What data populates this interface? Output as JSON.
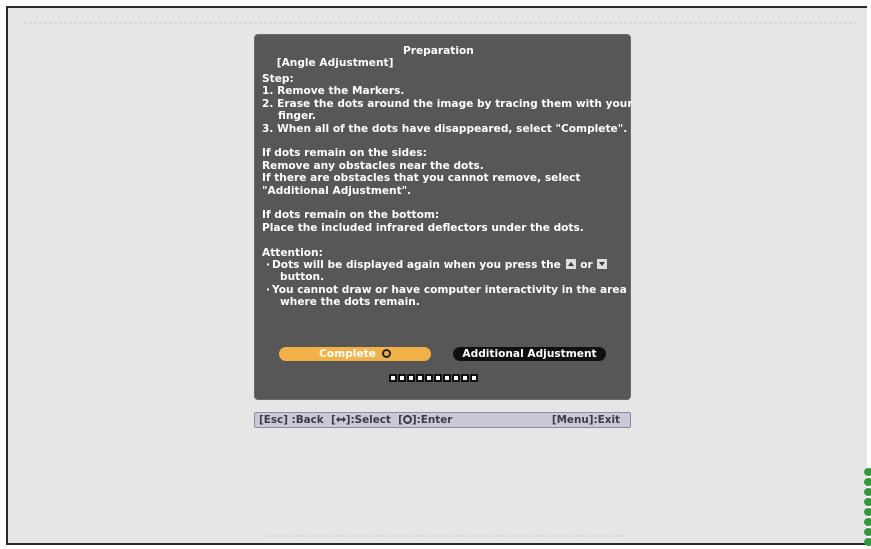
{
  "dialog": {
    "title": "[Angle Adjustment]",
    "subtitle": "Preparation",
    "steps_heading": "Step:",
    "step1": "1. Remove the Markers.",
    "step2_a": "2. Erase the dots around the image by tracing them with your",
    "step2_b": "finger.",
    "step3": "3. When all of the dots have disappeared, select \"Complete\".",
    "sides_heading": "If dots remain on the sides:",
    "sides_1": "Remove any obstacles near the dots.",
    "sides_2": "If there are obstacles that you cannot remove, select",
    "sides_3": "\"Additional Adjustment\".",
    "bottom_heading": "If dots remain on the bottom:",
    "bottom_1": "Place the included infrared deflectors under the dots.",
    "attention_heading": "Attention:",
    "att1_a_pre": "Dots will be displayed again when you press the",
    "att1_a_or": "or",
    "att1_b": "button.",
    "att2_a": "You cannot draw or have computer interactivity in the area",
    "att2_b": "where the dots remain.",
    "bullet": "·",
    "complete_label": "Complete",
    "additional_label": "Additional Adjustment",
    "progress_count": 10
  },
  "help_bar": {
    "back": "[Esc] :Back",
    "select_pre": "[",
    "select_post": "]:Select",
    "enter_pre": "[",
    "enter_post": "]:Enter",
    "exit": "[Menu]:Exit"
  },
  "icons": {
    "up": "arrow-up-icon",
    "down": "arrow-down-icon",
    "enter": "enter-icon",
    "select": "direction-icon"
  },
  "colors": {
    "dialog_bg": "#575757",
    "complete_bg": "#f3b247",
    "additional_bg": "#101010",
    "help_bar_bg": "#c9c9d8",
    "screen_bg": "#e6e6e6",
    "green_dots": "#2f9a3a"
  }
}
